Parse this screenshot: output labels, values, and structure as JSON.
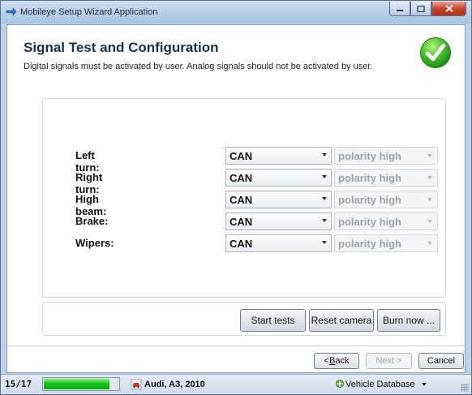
{
  "window": {
    "title": "Mobileye Setup Wizard Application",
    "icon": "wizard-arrow-icon",
    "controls": [
      "minimize",
      "maximize",
      "close"
    ]
  },
  "header": {
    "title": "Signal Test and Configuration",
    "subtitle": "Digital signals must be activated by user. Analog signals should not be activated by user.",
    "status_icon": "green-checkmark-icon"
  },
  "signals": [
    {
      "label": "Left turn:",
      "source": "CAN",
      "polarity": "polarity high"
    },
    {
      "label": "Right turn:",
      "source": "CAN",
      "polarity": "polarity high"
    },
    {
      "label": "High beam:",
      "source": "CAN",
      "polarity": "polarity high"
    },
    {
      "label": "Brake:",
      "source": "CAN",
      "polarity": "polarity high"
    },
    {
      "label": "Wipers:",
      "source": "CAN",
      "polarity": "polarity high"
    }
  ],
  "actions": {
    "start_tests": "Start tests",
    "reset_camera": "Reset camera",
    "burn_now": "Burn now ..."
  },
  "nav": {
    "back_prefix": "< ",
    "back_key": "B",
    "back_rest": "ack",
    "next": "Next >",
    "cancel": "Cancel"
  },
  "status": {
    "step": "15/17",
    "progress_fraction": 0.88,
    "vehicle": "Audi, A3, 2010",
    "database": "Vehicle Database"
  },
  "colors": {
    "progress": "#17c31a",
    "check_badge": "#3cb521",
    "title_text": "#1a2f4a"
  }
}
